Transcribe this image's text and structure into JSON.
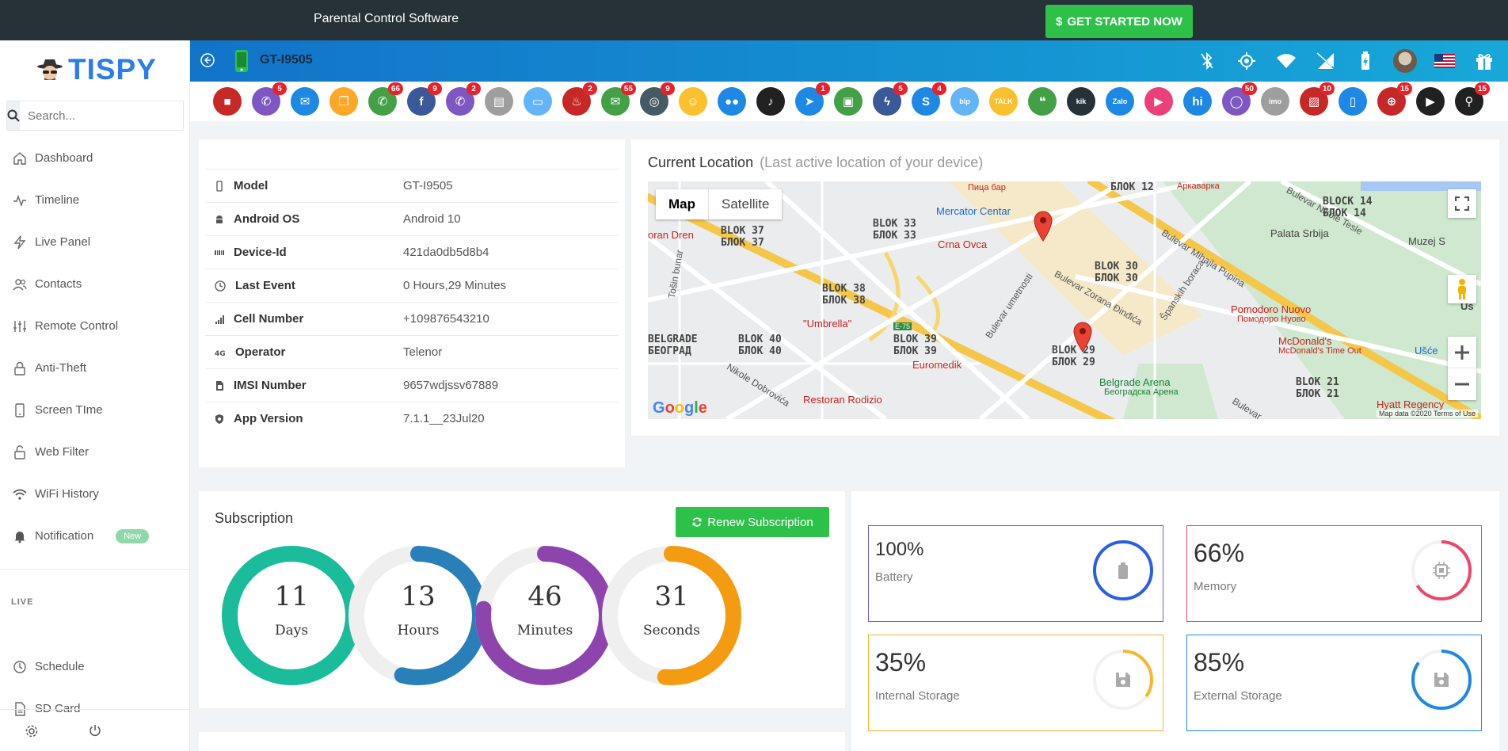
{
  "promo": {
    "text": "Parental Control Software",
    "cta": "GET STARTED NOW",
    "cta_icon": "$"
  },
  "brand": {
    "name": "TISPY"
  },
  "search": {
    "placeholder": "Search..."
  },
  "nav": [
    {
      "label": "Dashboard",
      "icon": "home-icon"
    },
    {
      "label": "Timeline",
      "icon": "activity-icon"
    },
    {
      "label": "Live Panel",
      "icon": "bolt-icon"
    },
    {
      "label": "Contacts",
      "icon": "users-icon"
    },
    {
      "label": "Remote Control",
      "icon": "sliders-icon"
    },
    {
      "label": "Anti-Theft",
      "icon": "lock-icon"
    },
    {
      "label": "Screen TIme",
      "icon": "tablet-icon"
    },
    {
      "label": "Web Filter",
      "icon": "unlock-icon"
    },
    {
      "label": "WiFi History",
      "icon": "wifi-icon"
    },
    {
      "label": "Notification",
      "icon": "bell-icon",
      "badge": "New"
    }
  ],
  "live_section": {
    "label": "LIVE"
  },
  "live_nav": [
    {
      "label": "Schedule",
      "icon": "clock-icon"
    },
    {
      "label": "SD Card",
      "icon": "file-icon"
    }
  ],
  "device": {
    "model": "GT-I9505"
  },
  "apps": [
    {
      "icon": "zoom-video-icon",
      "color": "#c62828",
      "glyph": "■",
      "count": ""
    },
    {
      "icon": "phone-icon",
      "color": "#7e57c2",
      "glyph": "✆",
      "count": "5"
    },
    {
      "icon": "email-icon",
      "color": "#1e88e5",
      "glyph": "✉",
      "count": ""
    },
    {
      "icon": "clipboard-icon",
      "color": "#ffa726",
      "glyph": "❐",
      "count": ""
    },
    {
      "icon": "whatsapp-icon",
      "color": "#43a047",
      "glyph": "✆",
      "count": "66"
    },
    {
      "icon": "facebook-icon",
      "color": "#3b5998",
      "glyph": "f",
      "count": "9"
    },
    {
      "icon": "viber-icon",
      "color": "#7e57c2",
      "glyph": "✆",
      "count": "2"
    },
    {
      "icon": "notes-icon",
      "color": "#9e9e9e",
      "glyph": "▤",
      "count": ""
    },
    {
      "icon": "screen-icon",
      "color": "#64b5f6",
      "glyph": "▭",
      "count": ""
    },
    {
      "icon": "tinder-icon",
      "color": "#c62828",
      "glyph": "♨",
      "count": "2"
    },
    {
      "icon": "wechat-icon",
      "color": "#43a047",
      "glyph": "✉",
      "count": "55"
    },
    {
      "icon": "instagram-icon",
      "color": "#455a64",
      "glyph": "◎",
      "count": "9"
    },
    {
      "icon": "snapchat-icon",
      "color": "#fbc02d",
      "glyph": "☺",
      "count": ""
    },
    {
      "icon": "flickr-icon",
      "color": "#1e88e5",
      "glyph": "●●",
      "count": ""
    },
    {
      "icon": "tiktok-icon",
      "color": "#212121",
      "glyph": "♪",
      "count": ""
    },
    {
      "icon": "telegram-icon",
      "color": "#1e88e5",
      "glyph": "➤",
      "count": "1"
    },
    {
      "icon": "line-icon",
      "color": "#43a047",
      "glyph": "▣",
      "count": ""
    },
    {
      "icon": "messenger-icon",
      "color": "#3b5998",
      "glyph": "ϟ",
      "count": "5"
    },
    {
      "icon": "skype-icon",
      "color": "#1e88e5",
      "glyph": "S",
      "count": "4"
    },
    {
      "icon": "bip-icon",
      "color": "#64b5f6",
      "glyph": "bip",
      "count": ""
    },
    {
      "icon": "kakaotalk-icon",
      "color": "#fbc02d",
      "glyph": "TALK",
      "count": ""
    },
    {
      "icon": "hangouts-icon",
      "color": "#43a047",
      "glyph": "❝",
      "count": ""
    },
    {
      "icon": "kik-icon",
      "color": "#263238",
      "glyph": "kik",
      "count": ""
    },
    {
      "icon": "zalo-icon",
      "color": "#1e88e5",
      "glyph": "Zalo",
      "count": ""
    },
    {
      "icon": "video-chat-icon",
      "color": "#ec407a",
      "glyph": "▶",
      "count": ""
    },
    {
      "icon": "hike-icon",
      "color": "#1e88e5",
      "glyph": "hi",
      "count": ""
    },
    {
      "icon": "signal-icon",
      "color": "#7e57c2",
      "glyph": "◯",
      "count": "50"
    },
    {
      "icon": "imo-icon",
      "color": "#9e9e9e",
      "glyph": "imo",
      "count": ""
    },
    {
      "icon": "gallery-icon",
      "color": "#c62828",
      "glyph": "▨",
      "count": "10"
    },
    {
      "icon": "mobile-icon",
      "color": "#1e88e5",
      "glyph": "▯",
      "count": ""
    },
    {
      "icon": "browser-icon",
      "color": "#c62828",
      "glyph": "⊕",
      "count": "15"
    },
    {
      "icon": "youtube-icon",
      "color": "#212121",
      "glyph": "▶",
      "count": ""
    },
    {
      "icon": "search-history-icon",
      "color": "#212121",
      "glyph": "⚲",
      "count": "15"
    }
  ],
  "device_info": [
    {
      "label": "Model",
      "value": "GT-I9505",
      "icon": "mobile-icon"
    },
    {
      "label": "Android OS",
      "value": "Android 10",
      "icon": "android-icon"
    },
    {
      "label": "Device-Id",
      "value": "421da0db5d8b4",
      "icon": "barcode-icon"
    },
    {
      "label": "Last Event",
      "value": "0 Hours,29 Minutes",
      "icon": "clock-icon"
    },
    {
      "label": "Cell Number",
      "value": "+109876543210",
      "icon": "signal-bars-icon"
    },
    {
      "label": "Operator",
      "value": "Telenor",
      "icon": "network-4g-icon"
    },
    {
      "label": "IMSI Number",
      "value": "9657wdjssv67889",
      "icon": "sim-icon"
    },
    {
      "label": "App Version",
      "value": "7.1.1__23Jul20",
      "icon": "shield-icon"
    }
  ],
  "location": {
    "title": "Current Location",
    "subtitle": "(Last active location of your device)",
    "tab_map": "Map",
    "tab_satellite": "Satellite",
    "labels": {
      "blok37": "BLOK 37\nБЛОК 37",
      "blok33": "BLOK 33\nБЛОК 33",
      "blok38": "BLOK 38\nБЛОК 38",
      "blok40": "BLOK 40\nБЛОК 40",
      "blok39": "BLOK 39\nБЛОК 39",
      "blok29": "BLOK 29\nБЛОК 29",
      "blok30": "BLOK 30\nБЛОК 30",
      "blok14": "BLOCK 14\nБЛОК 14",
      "blok21": "BLOK 21\nБЛОК 21",
      "blok12": "БЛОК 12",
      "belgrade": "BELGRADE\nБЕОГРАД",
      "mercator": "Mercator Centar",
      "crna_ovca": "Crna Ovca",
      "umbrella": "\"Umbrella\"",
      "euromedik": "Euromedik",
      "restoran": "Restoran Rodizio",
      "arena": "Belgrade Arena",
      "arena_cyr": "Београдска Арена",
      "pomodoro": "Pomodoro Nuovo",
      "pomodoro_cyr": "Помодоро Нуово",
      "mcdonalds": "McDonald's",
      "mcdonalds_sub": "McDonald's Time Out",
      "palata": "Palata Srbija",
      "usce": "Ušće",
      "hyatt": "Hyatt Regency",
      "oran_dren": "oran Dren",
      "arkavarka": "Аркаварка",
      "pica_bar": "Пица бар",
      "bul_mihajla": "Bulevar Mihajla Pupina",
      "bul_nikole": "Bulevar Nikole Tesle",
      "bul_zorana": "Bulevar Zorana Đinđića",
      "bul_umetnosti": "Bulevar umetnosti",
      "spanskih": "Španskih boraca",
      "tosin": "Tošin bunar",
      "nikole_dob": "Nikole Dobrovića",
      "bulevar_short": "Bulevar",
      "usc": "Uš",
      "muzej": "Muzej S",
      "e75": "E-75"
    },
    "google": "Google",
    "map_data": "Map data ©2020",
    "terms": "Terms of Use"
  },
  "subscription": {
    "title": "Subscription",
    "renew_label": "Renew Subscription",
    "rings": [
      {
        "value": 11,
        "unit": "Days",
        "max": 11,
        "color": "#1abc9c"
      },
      {
        "value": 13,
        "unit": "Hours",
        "max": 24,
        "color": "#2980b9"
      },
      {
        "value": 46,
        "unit": "Minutes",
        "max": 60,
        "color": "#8e44ad"
      },
      {
        "value": 31,
        "unit": "Seconds",
        "max": 60,
        "color": "#f39c12"
      }
    ]
  },
  "stats": [
    {
      "value": "100%",
      "name": "Battery",
      "percent": 100,
      "color": "#2b5ee8",
      "border": "#7e57c2",
      "icon": "battery-icon"
    },
    {
      "value": "66%",
      "name": "Memory",
      "percent": 66,
      "color": "#f0456b",
      "border": "#f0456b",
      "icon": "chip-icon"
    },
    {
      "value": "35%",
      "name": "Internal Storage",
      "percent": 35,
      "color": "#f9b630",
      "border": "#f9b630",
      "icon": "save-icon"
    },
    {
      "value": "85%",
      "name": "External Storage",
      "percent": 85,
      "color": "#1e88e5",
      "border": "#1e88e5",
      "icon": "save-icon"
    }
  ]
}
